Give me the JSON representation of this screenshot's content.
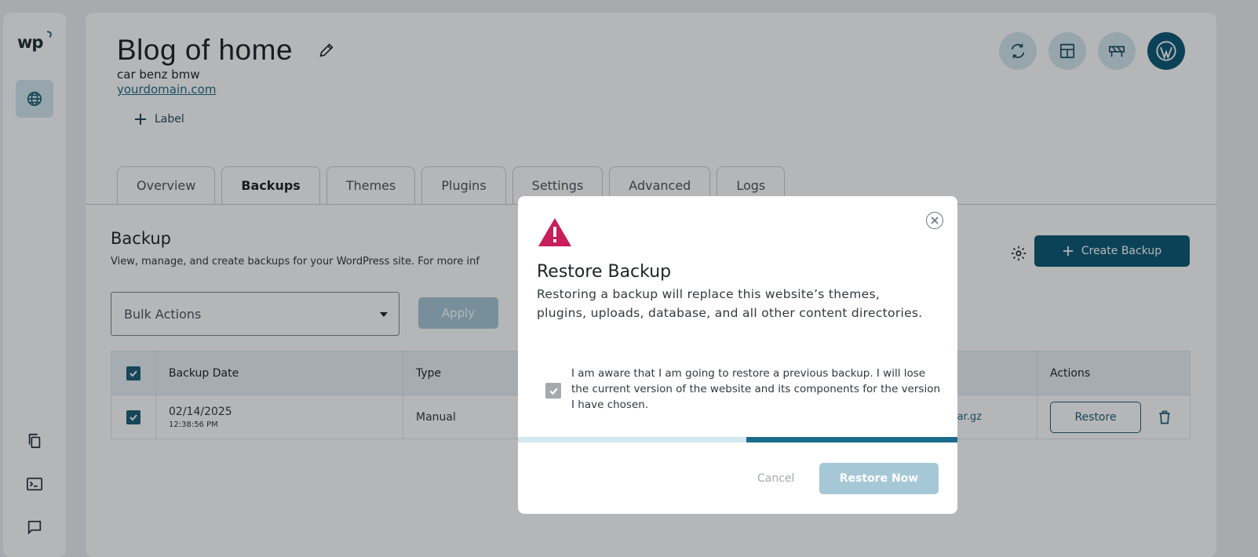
{
  "sidebar": {
    "logo": "wp",
    "icons": [
      "globe-icon",
      "copy-icon",
      "terminal-icon",
      "chat-icon"
    ]
  },
  "site": {
    "title": "Blog of home",
    "description": "car benz bmw",
    "domain": "yourdomain.com",
    "label_button": "Label"
  },
  "tabs": [
    "Overview",
    "Backups",
    "Themes",
    "Plugins",
    "Settings",
    "Advanced",
    "Logs"
  ],
  "active_tab": "Backups",
  "backup": {
    "title": "Backup",
    "description": "View, manage, and create backups for your WordPress site. For more inf",
    "create_button": "Create Backup",
    "bulk_actions": "Bulk Actions",
    "apply": "Apply"
  },
  "table": {
    "headers": [
      "Backup Date",
      "Type",
      "",
      "Actions"
    ],
    "rows": [
      {
        "date": "02/14/2025",
        "time": "12:38:56 PM",
        "type": "Manual",
        "file": "ar.gz",
        "action": "Restore"
      }
    ]
  },
  "modal": {
    "title": "Restore Backup",
    "description": "Restoring a backup will replace this website’s themes, plugins, uploads, database, and all other content directories.",
    "checkbox_text": "I am aware that I am going to restore a previous backup. I will lose the current version of the website and its components for the version I have chosen.",
    "progress_percent": 48,
    "cancel": "Cancel",
    "confirm": "Restore Now"
  },
  "colors": {
    "primary": "#0e5a78",
    "primary_light": "#a6c8d6",
    "warning": "#c81e5a",
    "tint": "#d3e8f0"
  }
}
